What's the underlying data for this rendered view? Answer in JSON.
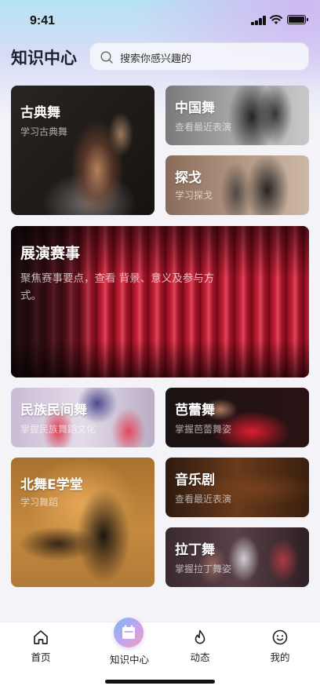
{
  "status_bar": {
    "time": "9:41"
  },
  "header": {
    "title": "知识中心",
    "search_placeholder": "搜索你感兴趣的"
  },
  "cards": {
    "classical": {
      "title": "古典舞",
      "subtitle": "学习古典舞"
    },
    "chinese": {
      "title": "中国舞",
      "subtitle": "查看最近表演"
    },
    "tango": {
      "title": "探戈",
      "subtitle": "学习探戈"
    },
    "events": {
      "title": "展演赛事",
      "subtitle": "聚焦赛事要点，查看 背景、意义及参与方式。"
    },
    "folk": {
      "title": "民族民间舞",
      "subtitle": "掌握民族舞蹈文化"
    },
    "ballet": {
      "title": "芭蕾舞",
      "subtitle": "掌握芭蕾舞姿"
    },
    "beiwu": {
      "title": "北舞E学堂",
      "subtitle": "学习舞蹈"
    },
    "musical": {
      "title": "音乐剧",
      "subtitle": "查看最近表演"
    },
    "latin": {
      "title": "拉丁舞",
      "subtitle": "掌握拉丁舞姿"
    }
  },
  "tabbar": {
    "items": [
      {
        "label": "首页",
        "icon": "home-icon"
      },
      {
        "label": "知识中心",
        "icon": "calendar-icon",
        "active": true
      },
      {
        "label": "动态",
        "icon": "flame-icon"
      },
      {
        "label": "我的",
        "icon": "smile-icon"
      }
    ]
  },
  "colors": {
    "accent_gradient_start": "#79b7f2",
    "accent_gradient_end": "#ee9fb8",
    "page_background": "#f3f3f8"
  }
}
